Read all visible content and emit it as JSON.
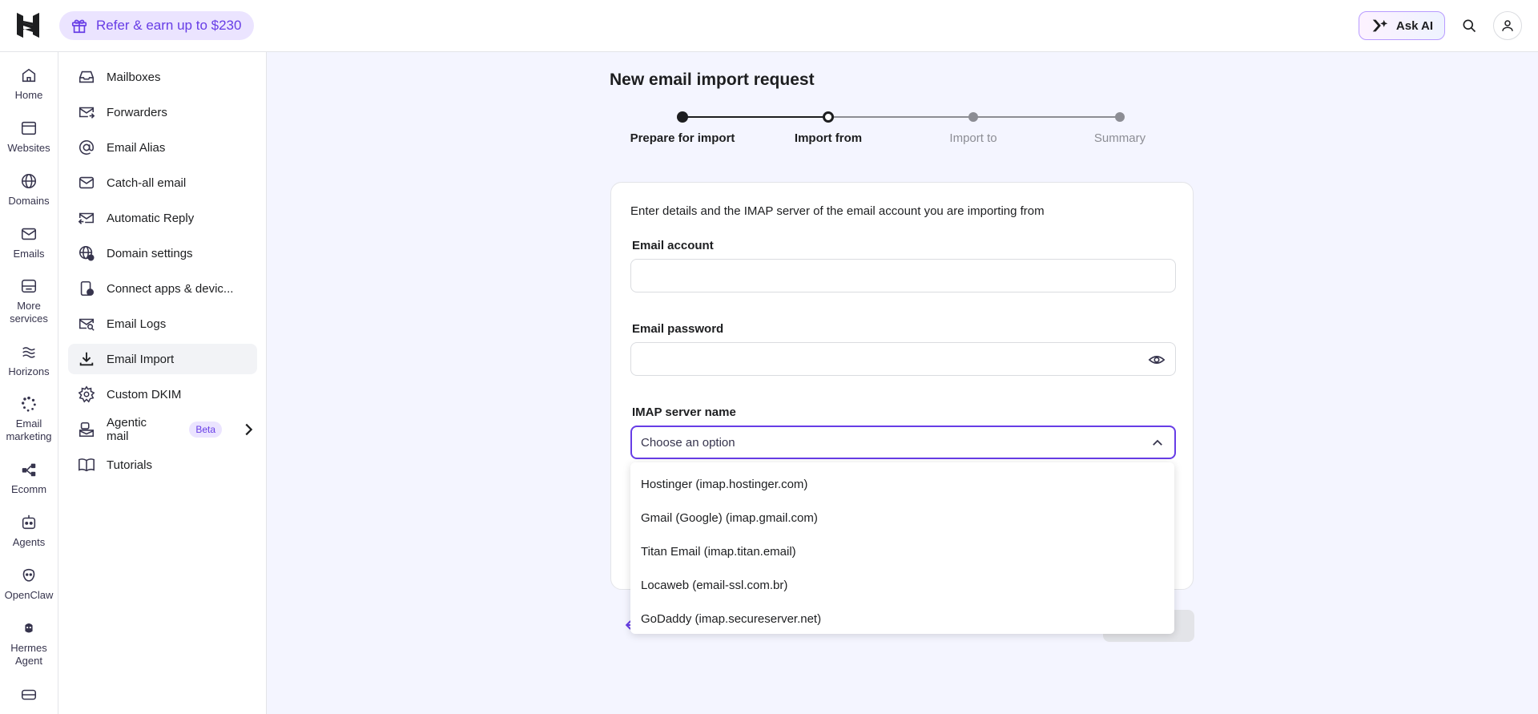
{
  "topbar": {
    "refer_label": "Refer & earn up to $230",
    "ask_ai_label": "Ask AI",
    "brand_color": "#673de6"
  },
  "rail": {
    "items": [
      {
        "label": "Home",
        "icon": "home-icon"
      },
      {
        "label": "Websites",
        "icon": "window-icon"
      },
      {
        "label": "Domains",
        "icon": "globe-icon"
      },
      {
        "label": "Emails",
        "icon": "mail-icon"
      },
      {
        "label": "More services",
        "icon": "box-icon"
      },
      {
        "label": "Horizons",
        "icon": "waves-icon"
      },
      {
        "label": "Email marketing",
        "icon": "spinner-icon"
      },
      {
        "label": "Ecomm",
        "icon": "share-icon"
      },
      {
        "label": "Agents",
        "icon": "bot-icon"
      },
      {
        "label": "OpenClaw",
        "icon": "claw-icon"
      },
      {
        "label": "Hermes Agent",
        "icon": "hermes-icon"
      },
      {
        "label": "",
        "icon": "storage-icon"
      }
    ]
  },
  "subnav": {
    "items": [
      {
        "label": "Mailboxes"
      },
      {
        "label": "Forwarders"
      },
      {
        "label": "Email Alias"
      },
      {
        "label": "Catch-all email"
      },
      {
        "label": "Automatic Reply"
      },
      {
        "label": "Domain settings"
      },
      {
        "label": "Connect apps & devic..."
      },
      {
        "label": "Email Logs"
      },
      {
        "label": "Email Import",
        "active": true
      },
      {
        "label": "Custom DKIM"
      },
      {
        "label": "Agentic mail",
        "badge": "Beta"
      },
      {
        "label": "Tutorials"
      }
    ]
  },
  "main": {
    "title": "New email import request",
    "steps": [
      {
        "label": "Prepare for import",
        "state": "done"
      },
      {
        "label": "Import from",
        "state": "current"
      },
      {
        "label": "Import to",
        "state": "todo"
      },
      {
        "label": "Summary",
        "state": "todo"
      }
    ],
    "intro": "Enter details and the IMAP server of the email account you are importing from",
    "email_account_label": "Email account",
    "email_account_value": "",
    "email_password_label": "Email password",
    "email_password_value": "",
    "imap_label": "IMAP server name",
    "imap_placeholder": "Choose an option",
    "imap_options": [
      "Hostinger (imap.hostinger.com)",
      "Gmail (Google) (imap.gmail.com)",
      "Titan Email (imap.titan.email)",
      "Locaweb (email-ssl.com.br)",
      "GoDaddy (imap.secureserver.net)"
    ]
  }
}
